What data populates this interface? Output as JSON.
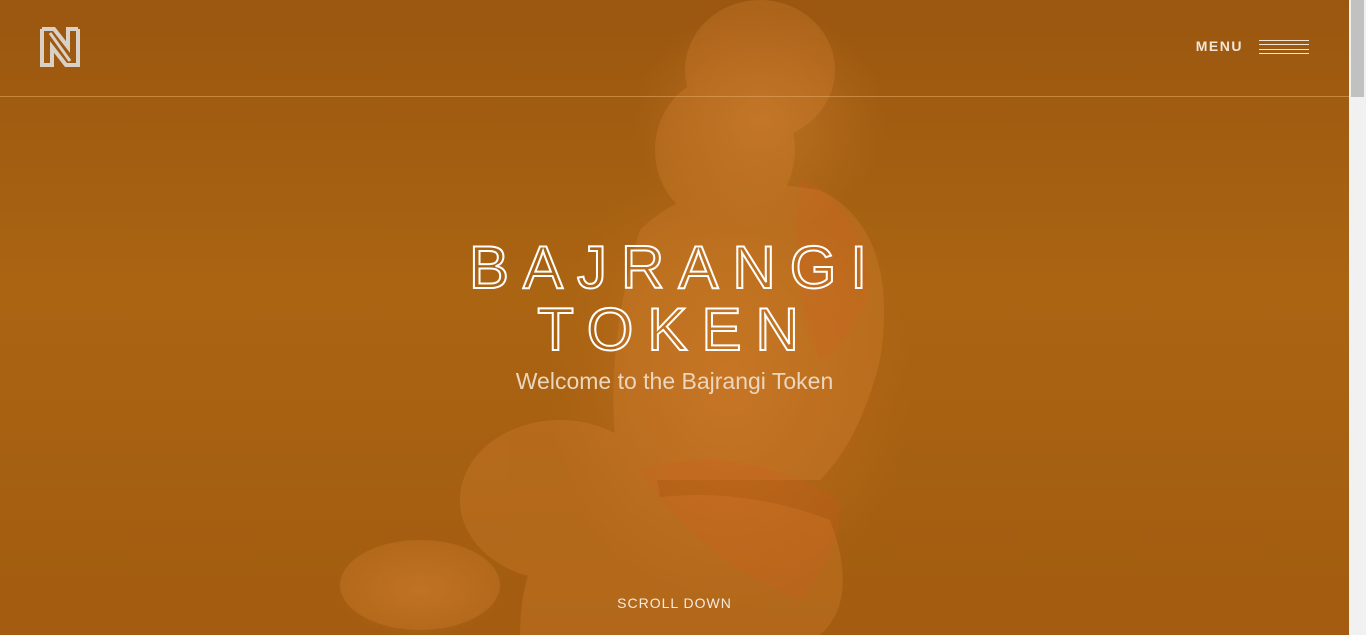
{
  "header": {
    "logo_icon": "n-logo-icon",
    "menu_label": "MENU",
    "menu_icon": "hamburger-icon"
  },
  "hero": {
    "title_line1": "BAJRANGI",
    "title_line2": "TOKEN",
    "subtitle": "Welcome to the Bajrangi Token",
    "scroll_label": "SCROLL DOWN"
  },
  "colors": {
    "background": "#a8600f",
    "text": "#ffffff",
    "subtitle": "#ecd6bd"
  }
}
